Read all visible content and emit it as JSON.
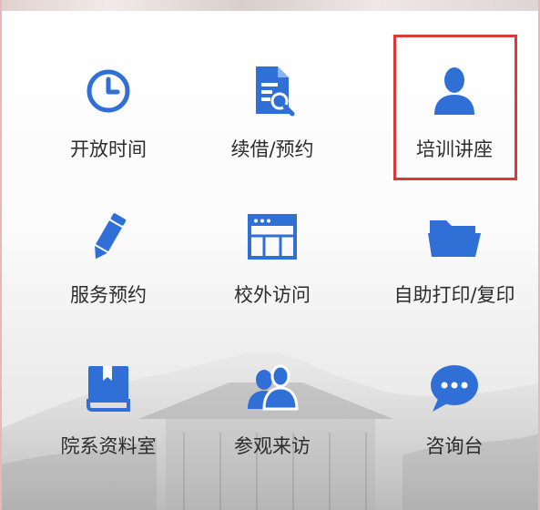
{
  "accent_color": "#2f6fd6",
  "highlight_color": "#d83a3a",
  "tiles": [
    {
      "label": "开放时间",
      "icon": "clock-icon"
    },
    {
      "label": "续借/预约",
      "icon": "document-search-icon"
    },
    {
      "label": "培训讲座",
      "icon": "person-icon"
    },
    {
      "label": "服务预约",
      "icon": "pencil-icon"
    },
    {
      "label": "校外访问",
      "icon": "browser-window-icon"
    },
    {
      "label": "自助打印/复印",
      "icon": "folder-icon"
    },
    {
      "label": "院系资料室",
      "icon": "book-icon"
    },
    {
      "label": "参观来访",
      "icon": "users-icon"
    },
    {
      "label": "咨询台",
      "icon": "chat-bubble-icon"
    }
  ]
}
